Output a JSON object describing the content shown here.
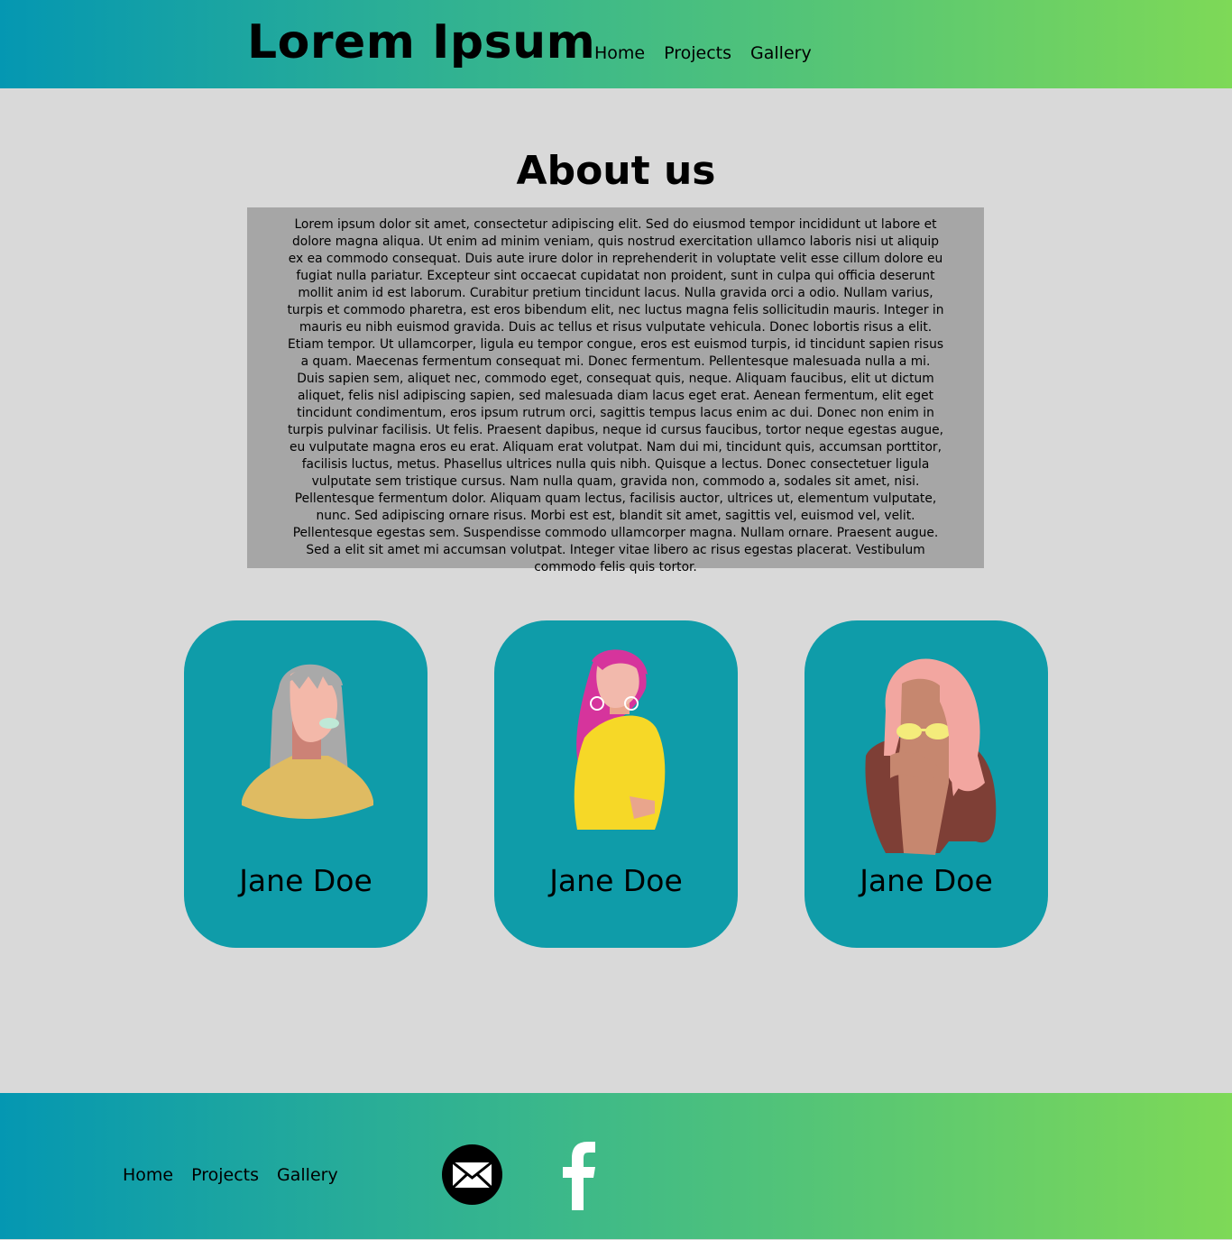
{
  "header": {
    "brand": "Lorem Ipsum",
    "nav": [
      "Home",
      "Projects",
      "Gallery"
    ]
  },
  "about": {
    "title": "About us",
    "text": "Lorem ipsum dolor sit amet, consectetur adipiscing elit. Sed do eiusmod tempor incididunt ut labore et dolore magna aliqua. Ut enim ad minim veniam, quis nostrud exercitation ullamco laboris nisi ut aliquip ex ea commodo consequat. Duis aute irure dolor in reprehenderit in voluptate velit esse cillum dolore eu fugiat nulla pariatur. Excepteur sint occaecat cupidatat non proident, sunt in culpa qui officia deserunt mollit anim id est laborum. Curabitur pretium tincidunt lacus. Nulla gravida orci a odio. Nullam varius, turpis et commodo pharetra, est eros bibendum elit, nec luctus magna felis sollicitudin mauris. Integer in mauris eu nibh euismod gravida. Duis ac tellus et risus vulputate vehicula. Donec lobortis risus a elit. Etiam tempor. Ut ullamcorper, ligula eu tempor congue, eros est euismod turpis, id tincidunt sapien risus a quam. Maecenas fermentum consequat mi. Donec fermentum. Pellentesque malesuada nulla a mi. Duis sapien sem, aliquet nec, commodo eget, consequat quis, neque. Aliquam faucibus, elit ut dictum aliquet, felis nisl adipiscing sapien, sed malesuada diam lacus eget erat. Aenean fermentum, elit eget tincidunt condimentum, eros ipsum rutrum orci, sagittis tempus lacus enim ac dui. Donec non enim in turpis pulvinar facilisis. Ut felis. Praesent dapibus, neque id cursus faucibus, tortor neque egestas augue, eu vulputate magna eros eu erat. Aliquam erat volutpat. Nam dui mi, tincidunt quis, accumsan porttitor, facilisis luctus, metus. Phasellus ultrices nulla quis nibh. Quisque a lectus. Donec consectetuer ligula vulputate sem tristique cursus. Nam nulla quam, gravida non, commodo a, sodales sit amet, nisi. Pellentesque fermentum dolor. Aliquam quam lectus, facilisis auctor, ultrices ut, elementum vulputate, nunc. Sed adipiscing ornare risus. Morbi est est, blandit sit amet, sagittis vel, euismod vel, velit. Pellentesque egestas sem. Suspendisse commodo ullamcorper magna. Nullam ornare. Praesent augue. Sed a elit sit amet mi accumsan volutpat. Integer vitae libero ac risus egestas placerat. Vestibulum commodo felis quis tortor."
  },
  "team": [
    {
      "name": "Jane Doe",
      "avatar": "woman-gray-hair-avatar"
    },
    {
      "name": "Jane Doe",
      "avatar": "woman-pink-hair-avatar"
    },
    {
      "name": "Jane Doe",
      "avatar": "woman-sunglasses-avatar"
    }
  ],
  "footer": {
    "nav": [
      "Home",
      "Projects",
      "Gallery"
    ],
    "social": [
      "mail-icon",
      "facebook-icon"
    ]
  },
  "colors": {
    "gradient_start": "#0497b2",
    "gradient_end": "#7ed957",
    "page_bg": "#d9d9d9",
    "text_box_bg": "#a6a6a6",
    "card_bg": "#0f9ca9"
  }
}
